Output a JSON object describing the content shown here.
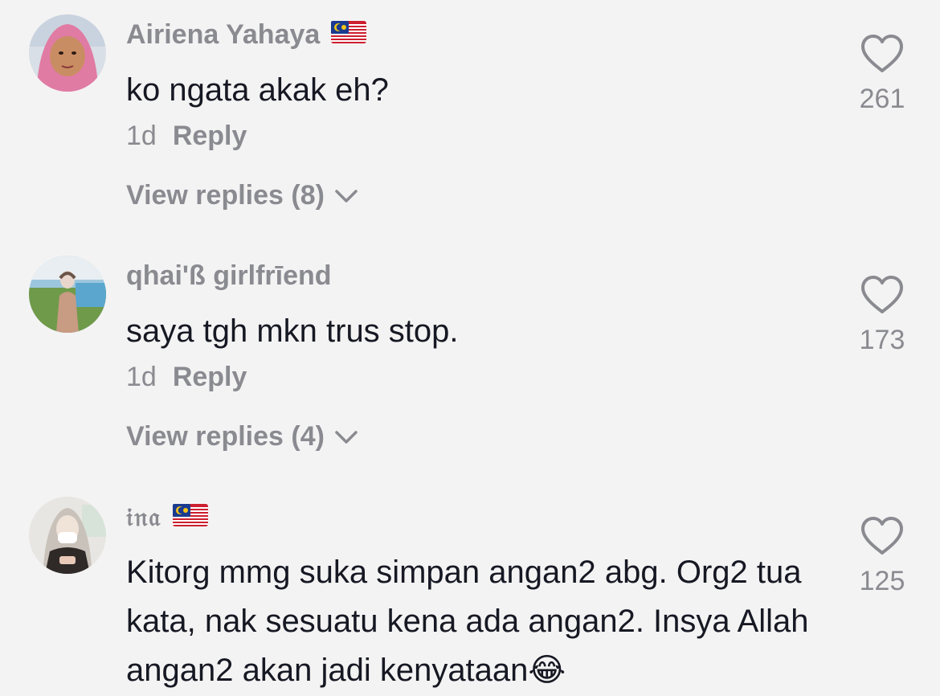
{
  "comments": [
    {
      "username": "Airiena Yahaya",
      "flag": "malaysia-flag",
      "text": "ko ngata akak eh?",
      "time": "1d",
      "reply_label": "Reply",
      "view_replies": "View replies (8)",
      "likes": "261",
      "like_icon": "heart-outline-icon"
    },
    {
      "username": "qhai'ß girlfrīend",
      "flag": "",
      "text": "saya tgh mkn trus stop.",
      "time": "1d",
      "reply_label": "Reply",
      "view_replies": "View replies (4)",
      "likes": "173",
      "like_icon": "heart-outline-icon"
    },
    {
      "username": "𝔦𝔫𝔞",
      "flag": "malaysia-flag",
      "text": "Kitorg mmg suka simpan angan2 abg. Org2 tua kata, nak sesuatu kena ada angan2. Insya Allah angan2 akan jadi kenyataan😂",
      "likes": "125",
      "like_icon": "heart-outline-icon"
    }
  ],
  "colors": {
    "background": "#f4f3f3",
    "primary_text": "#161823",
    "secondary_text": "#8a8b91"
  }
}
